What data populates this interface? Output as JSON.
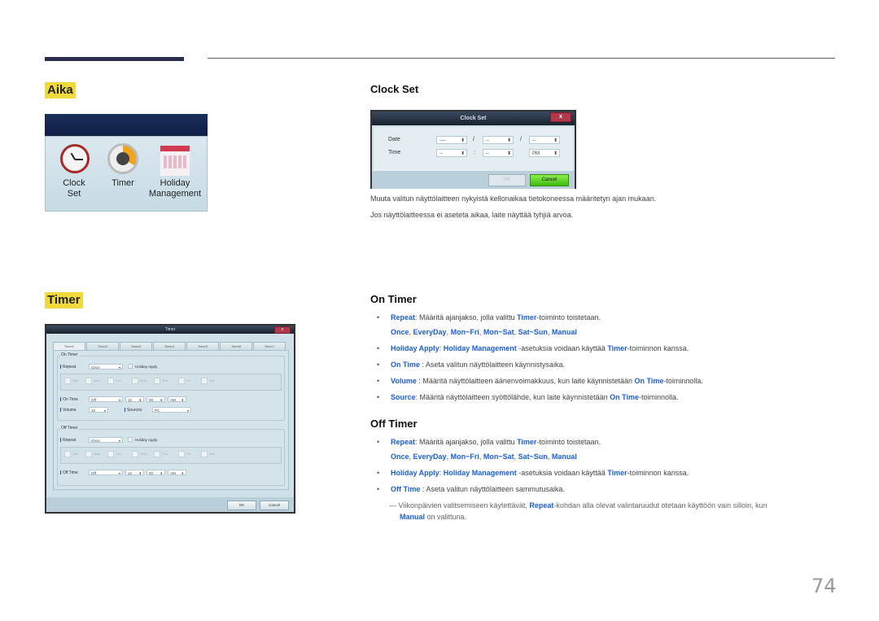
{
  "sections": {
    "aika": {
      "title": "Aika",
      "icons": [
        {
          "icon": "clock-icon",
          "label_lines": [
            "Clock",
            "Set"
          ]
        },
        {
          "icon": "timer-icon",
          "label_lines": [
            "Timer",
            ""
          ]
        },
        {
          "icon": "calendar-icon",
          "label_lines": [
            "Holiday",
            "Management"
          ]
        }
      ]
    },
    "timer": {
      "title": "Timer"
    }
  },
  "clock_set": {
    "heading": "Clock Set",
    "dialog": {
      "title": "Clock Set",
      "close": "x",
      "date_label": "Date",
      "time_label": "Time",
      "date_year": "----",
      "date_month": "--",
      "date_day": "--",
      "date_sep": "/",
      "time_hour": "--",
      "time_minute": "--",
      "time_sep": ":",
      "ampm": "PM",
      "spin_arrow": "⬍",
      "ok": "OK",
      "cancel": "Cancel"
    },
    "paragraphs": [
      "Muuta valitun näyttölaitteen nykyistä kellonaikaa tietokoneessa määritetyn ajan mukaan.",
      "Jos näyttölaitteessa ei aseteta aikaa, laite näyttää tyhjiä arvoa."
    ]
  },
  "timer_dialog": {
    "title": "Timer",
    "close": "x",
    "tabs": [
      "Timer1",
      "Timer2",
      "Timer3",
      "Timer4",
      "Timer5",
      "Timer6",
      "Timer7"
    ],
    "on_timer": {
      "group_label": "On Timer",
      "repeat_label": "Repeat",
      "repeat_value": "Once",
      "holiday_apply": "Holiday Apply",
      "days": [
        "Sun",
        "Mon",
        "Tue",
        "Wed",
        "Thu",
        "Fri",
        "Sat"
      ],
      "on_time_label": "On Time",
      "on_time_value": "Off",
      "hour": "12",
      "minute": "00",
      "ampm": "AM",
      "volume_label": "Volume",
      "volume_value": "10",
      "sources_label": "Sources",
      "sources_value": "PC"
    },
    "off_timer": {
      "group_label": "Off Timer",
      "repeat_label": "Repeat",
      "repeat_value": "Once",
      "holiday_apply": "Holiday Apply",
      "days": [
        "Sun",
        "Mon",
        "Tue",
        "Wed",
        "Thu",
        "Fri",
        "Sat"
      ],
      "off_time_label": "Off Time",
      "off_time_value": "Off",
      "hour": "12",
      "minute": "00",
      "ampm": "AM"
    },
    "ok": "OK",
    "cancel": "Cancel",
    "dropdown_arrow": "▾",
    "spin_arrow": "⬍"
  },
  "on_timer_text": {
    "heading": "On Timer",
    "repeat_term": "Repeat",
    "repeat_desc_a": ": Määritä ajanjakso, jolla valittu ",
    "timer_term": "Timer",
    "repeat_desc_b": "-toiminto toistetaan.",
    "options": [
      "Once",
      "EveryDay",
      "Mon~Fri",
      "Mon~Sat",
      "Sat~Sun",
      "Manual"
    ],
    "holiday_term": "Holiday Apply",
    "holiday_sep": ": ",
    "holiday_mgmt_term": "Holiday Management",
    "holiday_desc_a": " -asetuksia voidaan käyttää ",
    "holiday_desc_b": "-toiminnon kanssa.",
    "on_time_term": "On Time",
    "on_time_desc": " : Aseta valitun näyttölaitteen käynnistysaika.",
    "volume_term": "Volume",
    "volume_desc_a": " : Määritä näyttölaitteen äänenvoimakkuus, kun laite käynnistetään ",
    "volume_desc_b": "-toiminnolla.",
    "source_term": "Source",
    "source_desc_a": ": Määritä näyttölaitteen syöttölähde, kun laite käynnistetään ",
    "source_desc_b": "-toiminnolla."
  },
  "off_timer_text": {
    "heading": "Off Timer",
    "repeat_term": "Repeat",
    "repeat_desc_a": ": Määritä ajanjakso, jolla valittu ",
    "timer_term": "Timer",
    "repeat_desc_b": "-toiminto toistetaan.",
    "options": [
      "Once",
      "EveryDay",
      "Mon~Fri",
      "Mon~Sat",
      "Sat~Sun",
      "Manual"
    ],
    "holiday_term": "Holiday Apply",
    "holiday_sep": ": ",
    "holiday_mgmt_term": "Holiday Management",
    "holiday_desc_a": " -asetuksia voidaan käyttää ",
    "holiday_desc_b": "-toiminnon kanssa.",
    "off_time_term": "Off Time",
    "off_time_desc": " : Aseta valitun näyttölaitteen sammutusaika."
  },
  "note": {
    "dash": "—",
    "text_a": " Viikonpäivien valitsemiseen käytettävät, ",
    "repeat_term": "Repeat",
    "text_b": "-kohdan alla olevat valintaruudut otetaan käyttöön vain silloin, kun",
    "manual_term": "Manual",
    "text_c": " on valittuna."
  },
  "page_number": "74",
  "colors": {
    "accent_blue": "#1a5fd8",
    "highlight_yellow": "#f0d93a",
    "bar_navy": "#2c2f52"
  }
}
